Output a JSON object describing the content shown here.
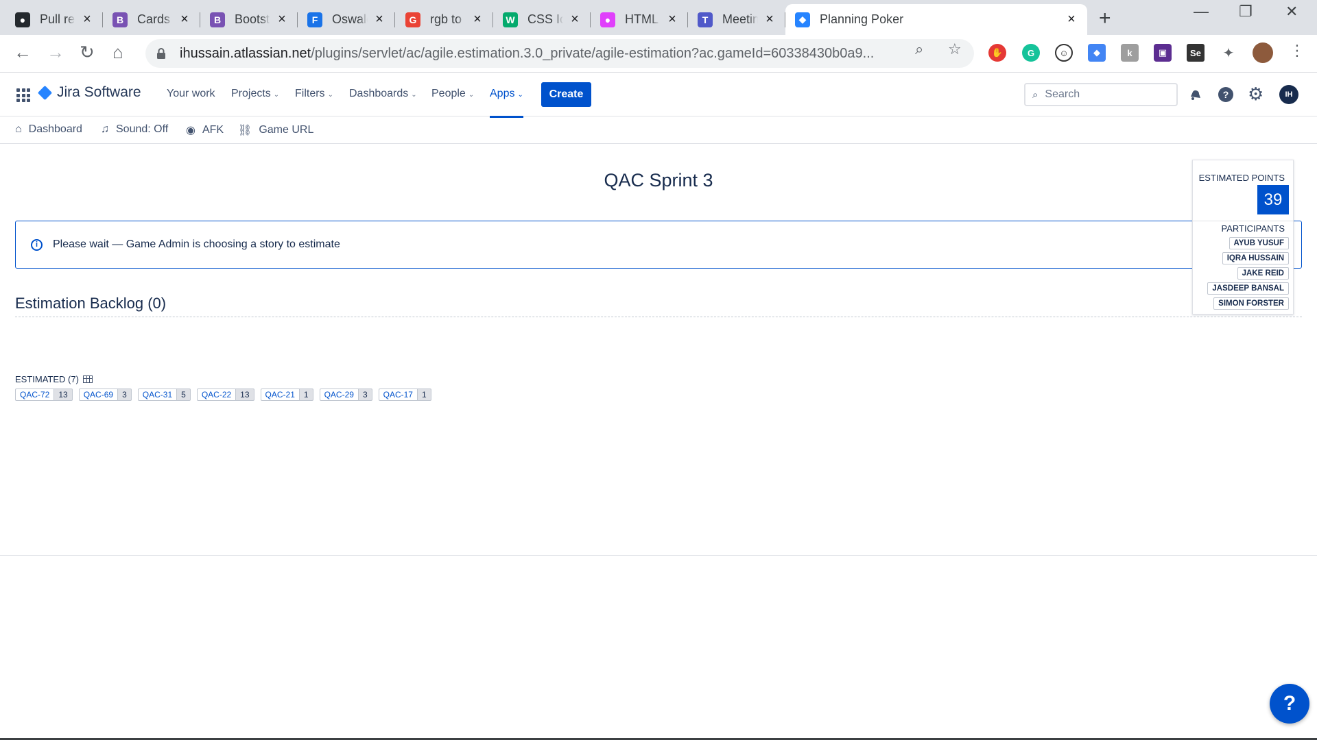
{
  "browser": {
    "tabs": [
      {
        "label": "Pull requests",
        "icon": "github-icon",
        "color": "#24292e",
        "glyph": "●"
      },
      {
        "label": "Cards · Bootstrap",
        "icon": "bootstrap-icon",
        "color": "#7952b3",
        "glyph": "B"
      },
      {
        "label": "Bootstrap",
        "icon": "bootstrap-icon",
        "color": "#7952b3",
        "glyph": "B"
      },
      {
        "label": "Oswald - Google Fonts",
        "icon": "fonts-icon",
        "color": "#1a73e8",
        "glyph": "F"
      },
      {
        "label": "rgb to hex",
        "icon": "google-icon",
        "color": "#ea4335",
        "glyph": "G"
      },
      {
        "label": "CSS Icons",
        "icon": "w3schools-icon",
        "color": "#04aa6d",
        "glyph": "W"
      },
      {
        "label": "HTML Colors",
        "icon": "color-wheel-icon",
        "color": "#e040fb",
        "glyph": "●"
      },
      {
        "label": "Meeting",
        "icon": "teams-icon",
        "color": "#5059c9",
        "glyph": "T"
      },
      {
        "label": "Planning Poker",
        "icon": "jira-icon",
        "color": "#2684ff",
        "glyph": "◆"
      }
    ],
    "url_host": "ihussain.atlassian.net",
    "url_path": "/plugins/servlet/ac/agile.estimation.3.0_private/agile-estimation?ac.gameId=60338430b0a9..."
  },
  "jira": {
    "product": "Jira Software",
    "nav": {
      "your_work": "Your work",
      "projects": "Projects",
      "filters": "Filters",
      "dashboards": "Dashboards",
      "people": "People",
      "apps": "Apps"
    },
    "create_label": "Create",
    "search_placeholder": "Search",
    "avatar_initials": "IH",
    "accent": "#0052cc"
  },
  "subbar": {
    "dashboard": "Dashboard",
    "sound": "Sound: Off",
    "afk": "AFK",
    "game_url": "Game URL"
  },
  "game": {
    "title": "QAC Sprint 3",
    "info_message": "Please wait — Game Admin is choosing a story to estimate",
    "backlog_title": "Estimation Backlog (0)",
    "estimated_label": "ESTIMATED (7)",
    "estimated": [
      {
        "key": "QAC-72",
        "points": "13"
      },
      {
        "key": "QAC-69",
        "points": "3"
      },
      {
        "key": "QAC-31",
        "points": "5"
      },
      {
        "key": "QAC-22",
        "points": "13"
      },
      {
        "key": "QAC-21",
        "points": "1"
      },
      {
        "key": "QAC-29",
        "points": "3"
      },
      {
        "key": "QAC-17",
        "points": "1"
      }
    ]
  },
  "panel": {
    "estimated_points_label": "ESTIMATED POINTS",
    "estimated_points": "39",
    "participants_label": "PARTICIPANTS",
    "participants": [
      "AYUB YUSUF",
      "IQRA HUSSAIN",
      "JAKE REID",
      "JASDEEP BANSAL",
      "SIMON FORSTER"
    ]
  },
  "help_label": "?"
}
